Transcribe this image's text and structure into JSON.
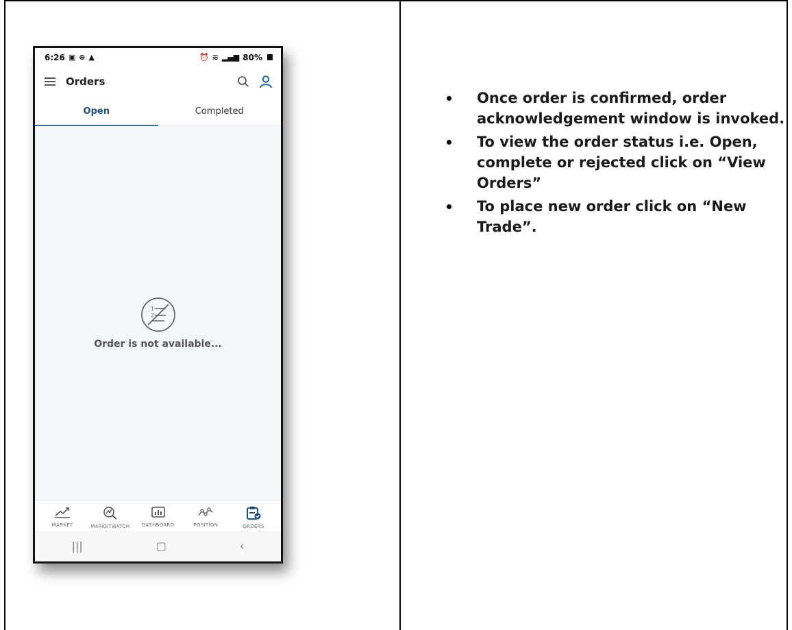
{
  "phone": {
    "status": {
      "time": "6:26",
      "battery": "80%"
    },
    "appbar": {
      "title": "Orders"
    },
    "tabs": [
      {
        "label": "Open",
        "active": true
      },
      {
        "label": "Completed",
        "active": false
      }
    ],
    "empty_message": "Order is not available...",
    "bottom_nav": [
      {
        "label": "MARKET",
        "icon": "chart-line-icon"
      },
      {
        "label": "MARKETWATCH",
        "icon": "watch-search-icon"
      },
      {
        "label": "DASHBOARD",
        "icon": "dashboard-icon"
      },
      {
        "label": "POSITION",
        "icon": "position-icon"
      },
      {
        "label": "ORDERS",
        "icon": "orders-icon",
        "active": true
      }
    ],
    "system_nav": {
      "recents": "|||",
      "home": "▢",
      "back": "‹"
    }
  },
  "notes": [
    "Once order is confirmed, order acknowledgement window is invoked.",
    "To view the order status i.e. Open, complete or rejected click on “View Orders”",
    "To place new order click on “New Trade”."
  ],
  "colors": {
    "accent": "#1f4e79",
    "tab_underline": "#2c6fa5",
    "background": "#f3f7fc"
  }
}
